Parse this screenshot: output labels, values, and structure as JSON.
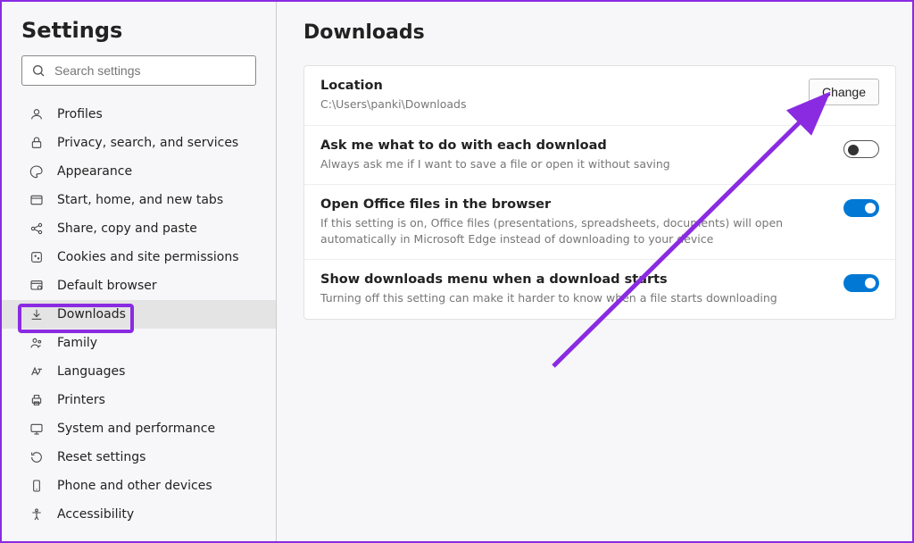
{
  "sidebar": {
    "title": "Settings",
    "search_placeholder": "Search settings",
    "items": [
      {
        "label": "Profiles",
        "icon": "profile-icon"
      },
      {
        "label": "Privacy, search, and services",
        "icon": "lock-icon"
      },
      {
        "label": "Appearance",
        "icon": "appearance-icon"
      },
      {
        "label": "Start, home, and new tabs",
        "icon": "tab-icon"
      },
      {
        "label": "Share, copy and paste",
        "icon": "share-icon"
      },
      {
        "label": "Cookies and site permissions",
        "icon": "cookie-icon"
      },
      {
        "label": "Default browser",
        "icon": "browser-icon"
      },
      {
        "label": "Downloads",
        "icon": "download-icon",
        "active": true
      },
      {
        "label": "Family",
        "icon": "family-icon"
      },
      {
        "label": "Languages",
        "icon": "language-icon"
      },
      {
        "label": "Printers",
        "icon": "printer-icon"
      },
      {
        "label": "System and performance",
        "icon": "system-icon"
      },
      {
        "label": "Reset settings",
        "icon": "reset-icon"
      },
      {
        "label": "Phone and other devices",
        "icon": "phone-icon"
      },
      {
        "label": "Accessibility",
        "icon": "accessibility-icon"
      }
    ]
  },
  "page": {
    "title": "Downloads",
    "rows": {
      "location": {
        "title": "Location",
        "desc": "C:\\Users\\panki\\Downloads",
        "button": "Change"
      },
      "ask": {
        "title": "Ask me what to do with each download",
        "desc": "Always ask me if I want to save a file or open it without saving",
        "toggle": "off"
      },
      "office": {
        "title": "Open Office files in the browser",
        "desc": "If this setting is on, Office files (presentations, spreadsheets, documents) will open automatically in Microsoft Edge instead of downloading to your device",
        "toggle": "on"
      },
      "menu": {
        "title": "Show downloads menu when a download starts",
        "desc": "Turning off this setting can make it harder to know when a file starts downloading",
        "toggle": "on"
      }
    }
  },
  "annotations": {
    "highlight_color": "#8a2be2"
  }
}
